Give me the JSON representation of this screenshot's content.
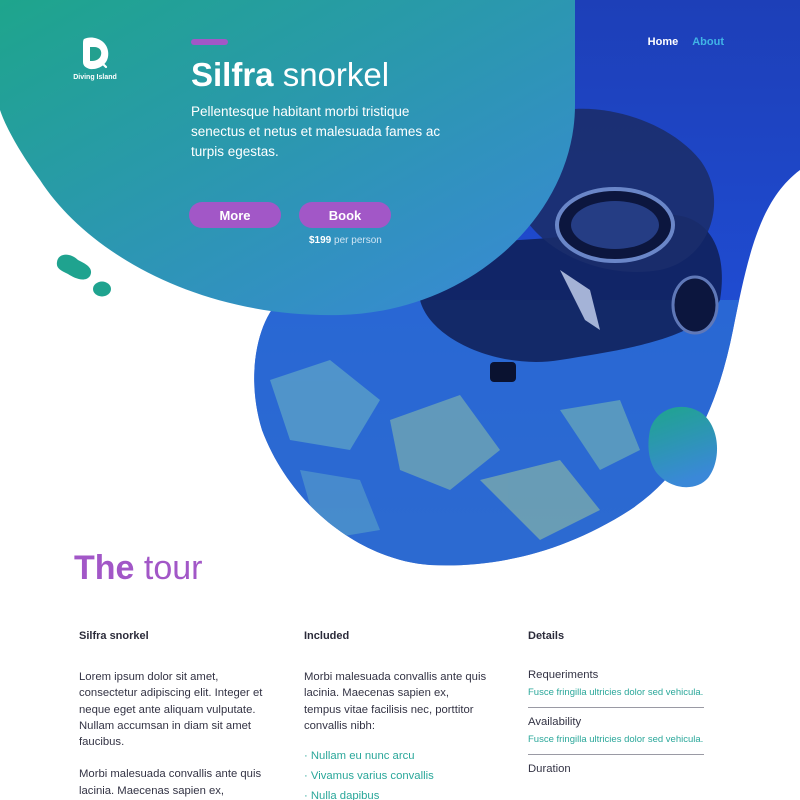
{
  "brand": {
    "name": "Diving Island"
  },
  "nav": {
    "home": "Home",
    "about": "About"
  },
  "hero": {
    "title_bold": "Silfra",
    "title_light": "snorkel",
    "description": "Pellentesque habitant morbi tristique senectus et netus et malesuada fames ac turpis egestas.",
    "more_label": "More",
    "book_label": "Book",
    "price": "$199",
    "price_unit": "per person"
  },
  "tour": {
    "title_bold": "The",
    "title_light": "tour",
    "columns": [
      {
        "heading": "Silfra snorkel",
        "paragraphs": [
          "Lorem ipsum dolor sit amet, consectetur adipiscing elit. Integer et neque eget ante aliquam vulputate. Nullam accumsan in diam sit amet faucibus.",
          "Morbi malesuada convallis ante quis lacinia. Maecenas sapien ex,"
        ]
      },
      {
        "heading": "Included",
        "paragraph": "Morbi malesuada convallis ante quis lacinia. Maecenas sapien ex, tempus vitae facilisis nec, porttitor convallis nibh:",
        "items": [
          "· Nullam eu nunc arcu",
          "· Vivamus varius convallis",
          "· Nulla dapibus"
        ]
      },
      {
        "heading": "Details",
        "details": [
          {
            "label": "Requeriments",
            "text": "Fusce fringilla ultricies dolor sed vehicula."
          },
          {
            "label": "Availability",
            "text": "Fusce fringilla ultricies dolor sed vehicula."
          },
          {
            "label": "Duration",
            "text": ""
          }
        ]
      }
    ]
  },
  "colors": {
    "accent": "#a257c7",
    "teal": "#1fa38f",
    "blue": "#3a86d6",
    "link": "#40b4e6"
  },
  "icons": [
    "logo-icon"
  ]
}
